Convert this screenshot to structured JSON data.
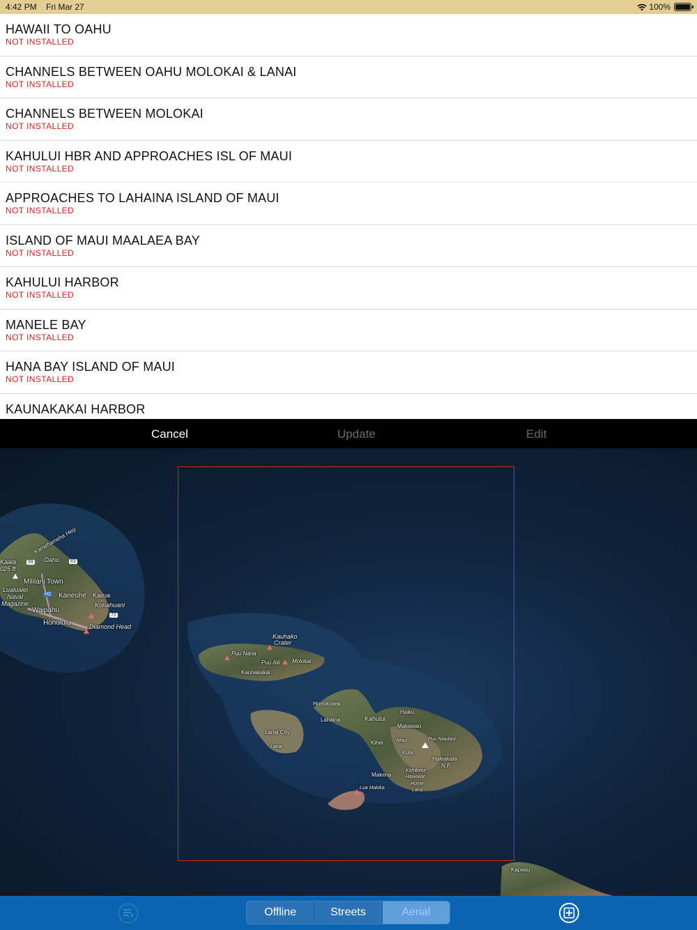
{
  "status_bar": {
    "time": "4:42 PM",
    "date": "Fri Mar 27",
    "battery": "100%",
    "icons": [
      "wifi-icon",
      "battery-icon"
    ]
  },
  "charts": [
    {
      "title": "HAWAII TO OAHU",
      "status": "NOT INSTALLED"
    },
    {
      "title": "CHANNELS BETWEEN OAHU MOLOKAI & LANAI",
      "status": "NOT INSTALLED"
    },
    {
      "title": "CHANNELS BETWEEN MOLOKAI",
      "status": "NOT INSTALLED"
    },
    {
      "title": "KAHULUI HBR AND APPROACHES ISL OF MAUI",
      "status": "NOT INSTALLED"
    },
    {
      "title": "APPROACHES TO LAHAINA ISLAND OF MAUI",
      "status": "NOT INSTALLED"
    },
    {
      "title": "ISLAND OF MAUI MAALAEA BAY",
      "status": "NOT INSTALLED"
    },
    {
      "title": "KAHULUI HARBOR",
      "status": "NOT INSTALLED"
    },
    {
      "title": "MANELE BAY",
      "status": "NOT INSTALLED"
    },
    {
      "title": "HANA BAY ISLAND OF MAUI",
      "status": "NOT INSTALLED"
    },
    {
      "title": "KAUNAKAKAI HARBOR",
      "status": ""
    }
  ],
  "action_bar": {
    "cancel": "Cancel",
    "update": "Update",
    "edit": "Edit"
  },
  "map": {
    "labels": {
      "oahu": "Oahu",
      "kaala": "Kaala",
      "ft": "025 ft",
      "mililani": "Mililani Town",
      "luualei": "Lualualei",
      "naval": "Naval",
      "magazine": "Magazine",
      "kaneohe": "Kaneohe",
      "kailua": "Kailua",
      "konahuani": "Konahuani",
      "waipahu": "Waipahu",
      "honolulu": "Honolulu",
      "diamond_head": "Diamond Head",
      "kamehameha": "Kamehameha Hwy",
      "h99": "99",
      "h83": "83",
      "h2": "H2",
      "h72": "72",
      "kauhako": "Kauhako",
      "crater": "Crater",
      "puu_nana": "Puu Nana",
      "puu_alii": "Puu Alii",
      "molokai": "Molokai",
      "kaunakakai": "Kaunakakai",
      "honokowai": "Honokowai",
      "lahaina": "Lahaina",
      "kahului": "Kahului",
      "haiku": "Haiku",
      "makawao": "Makawao",
      "lanai_city": "Lanai City",
      "lanai": "Lanai",
      "puu_niaulani": "Puu Niaulani",
      "kihei": "Kihei",
      "maui": "Maui",
      "kula": "Kula",
      "haleakala": "Haleakala",
      "np": "N.P.",
      "makena": "Makena",
      "kahikinui": "Kahikinui",
      "hawaiian": "Hawaiian",
      "home": "Home",
      "land": "Land",
      "lua_makika": "Lua Makika",
      "kapaau": "Kapaau"
    },
    "selection_color": "#e0221c"
  },
  "bottom_bar": {
    "segments": [
      "Offline",
      "Streets",
      "Aerial"
    ],
    "active_segment": "Aerial",
    "icons": [
      "menu-list-icon",
      "add-chart-icon"
    ],
    "accent": "#0a64b0"
  }
}
